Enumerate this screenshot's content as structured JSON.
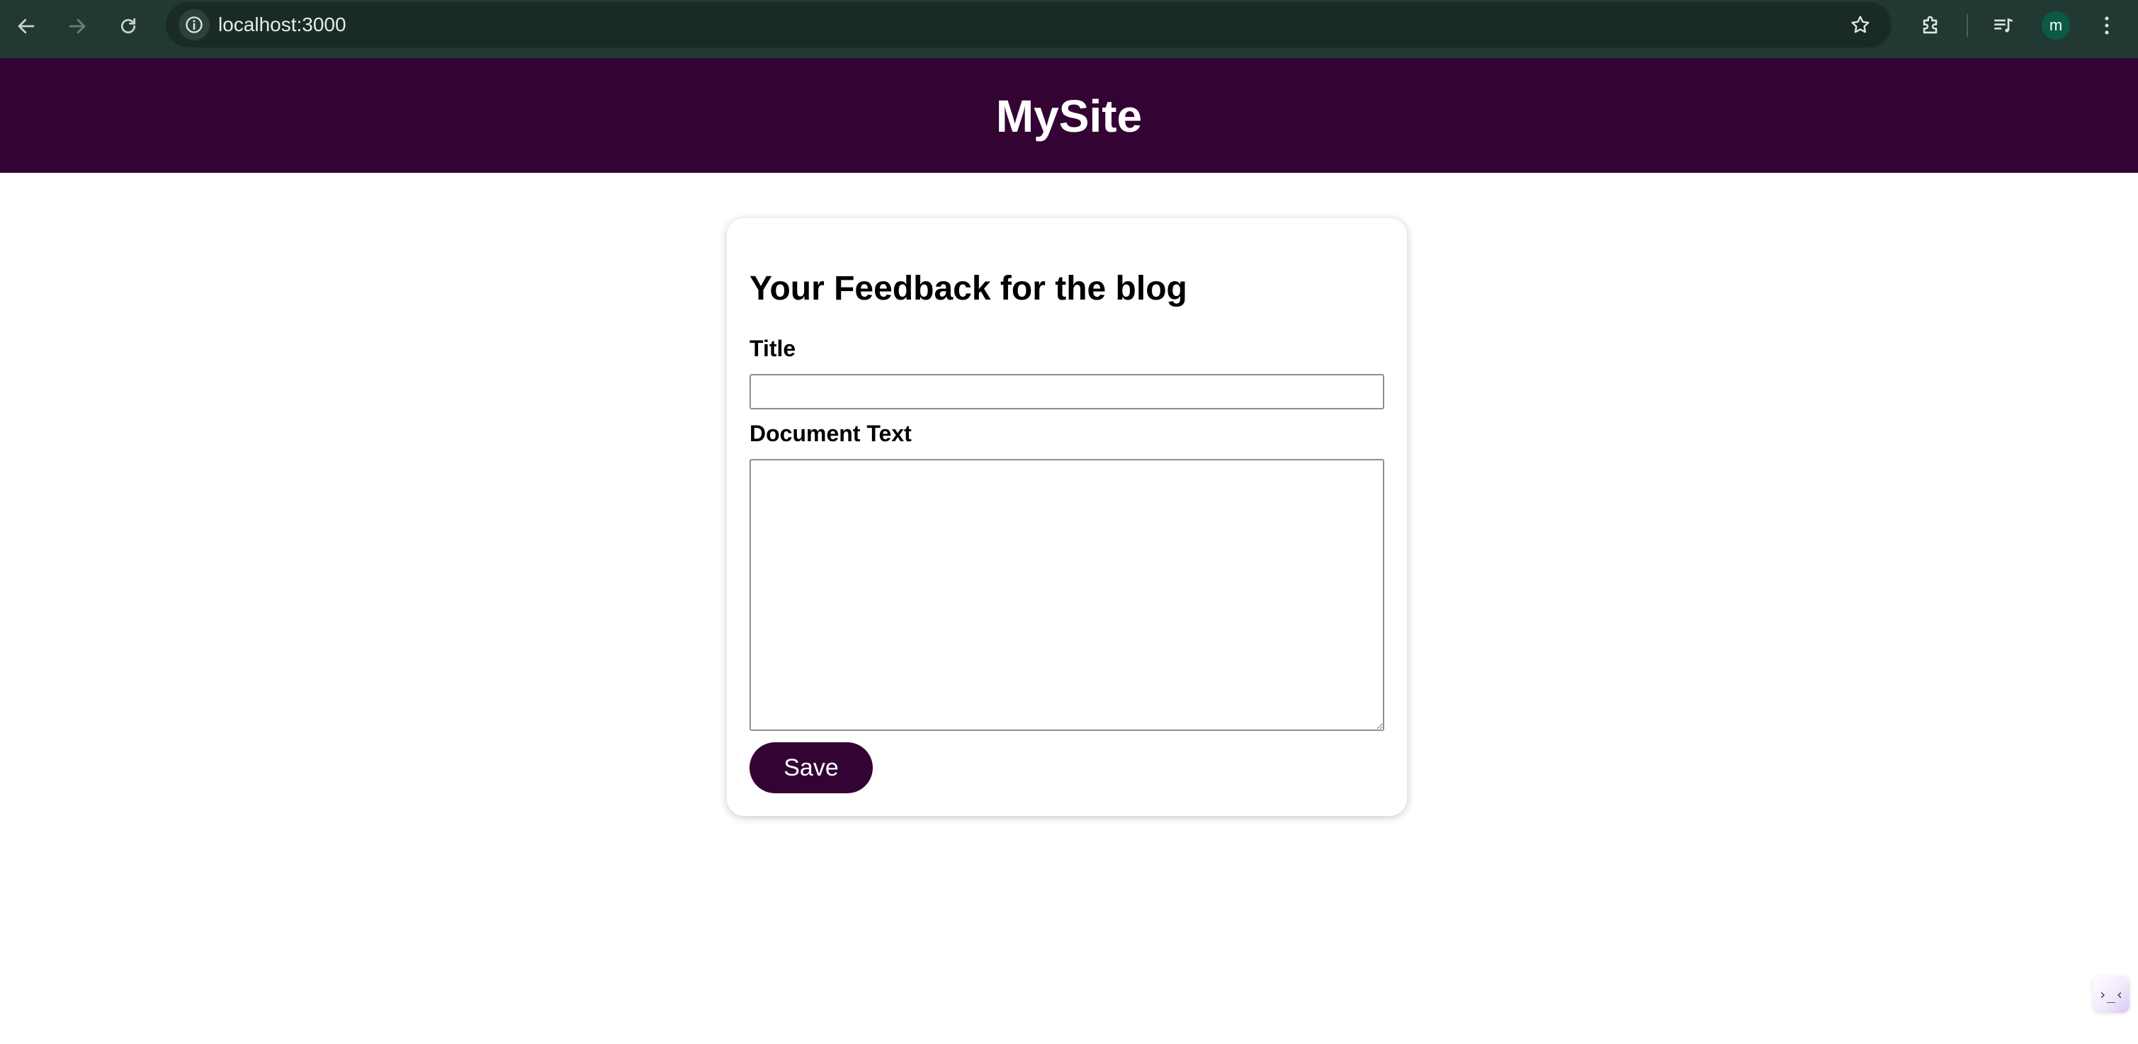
{
  "browser": {
    "url": "localhost:3000",
    "profile_initial": "m",
    "icons": {
      "back": "back-arrow-icon",
      "forward": "forward-arrow-icon",
      "reload": "reload-icon",
      "site_info": "info-icon",
      "bookmark": "star-icon",
      "extensions": "puzzle-icon",
      "media": "media-queue-icon",
      "menu": "kebab-menu-icon"
    }
  },
  "header": {
    "site_title": "MySite",
    "background_color": "#330433"
  },
  "form": {
    "heading": "Your Feedback for the blog",
    "title_label": "Title",
    "title_value": "",
    "document_label": "Document Text",
    "document_value": "",
    "save_label": "Save",
    "accent_color": "#330433"
  },
  "corner_widget": {
    "glyph": "›_‹",
    "icon": "assistant-widget-icon"
  }
}
